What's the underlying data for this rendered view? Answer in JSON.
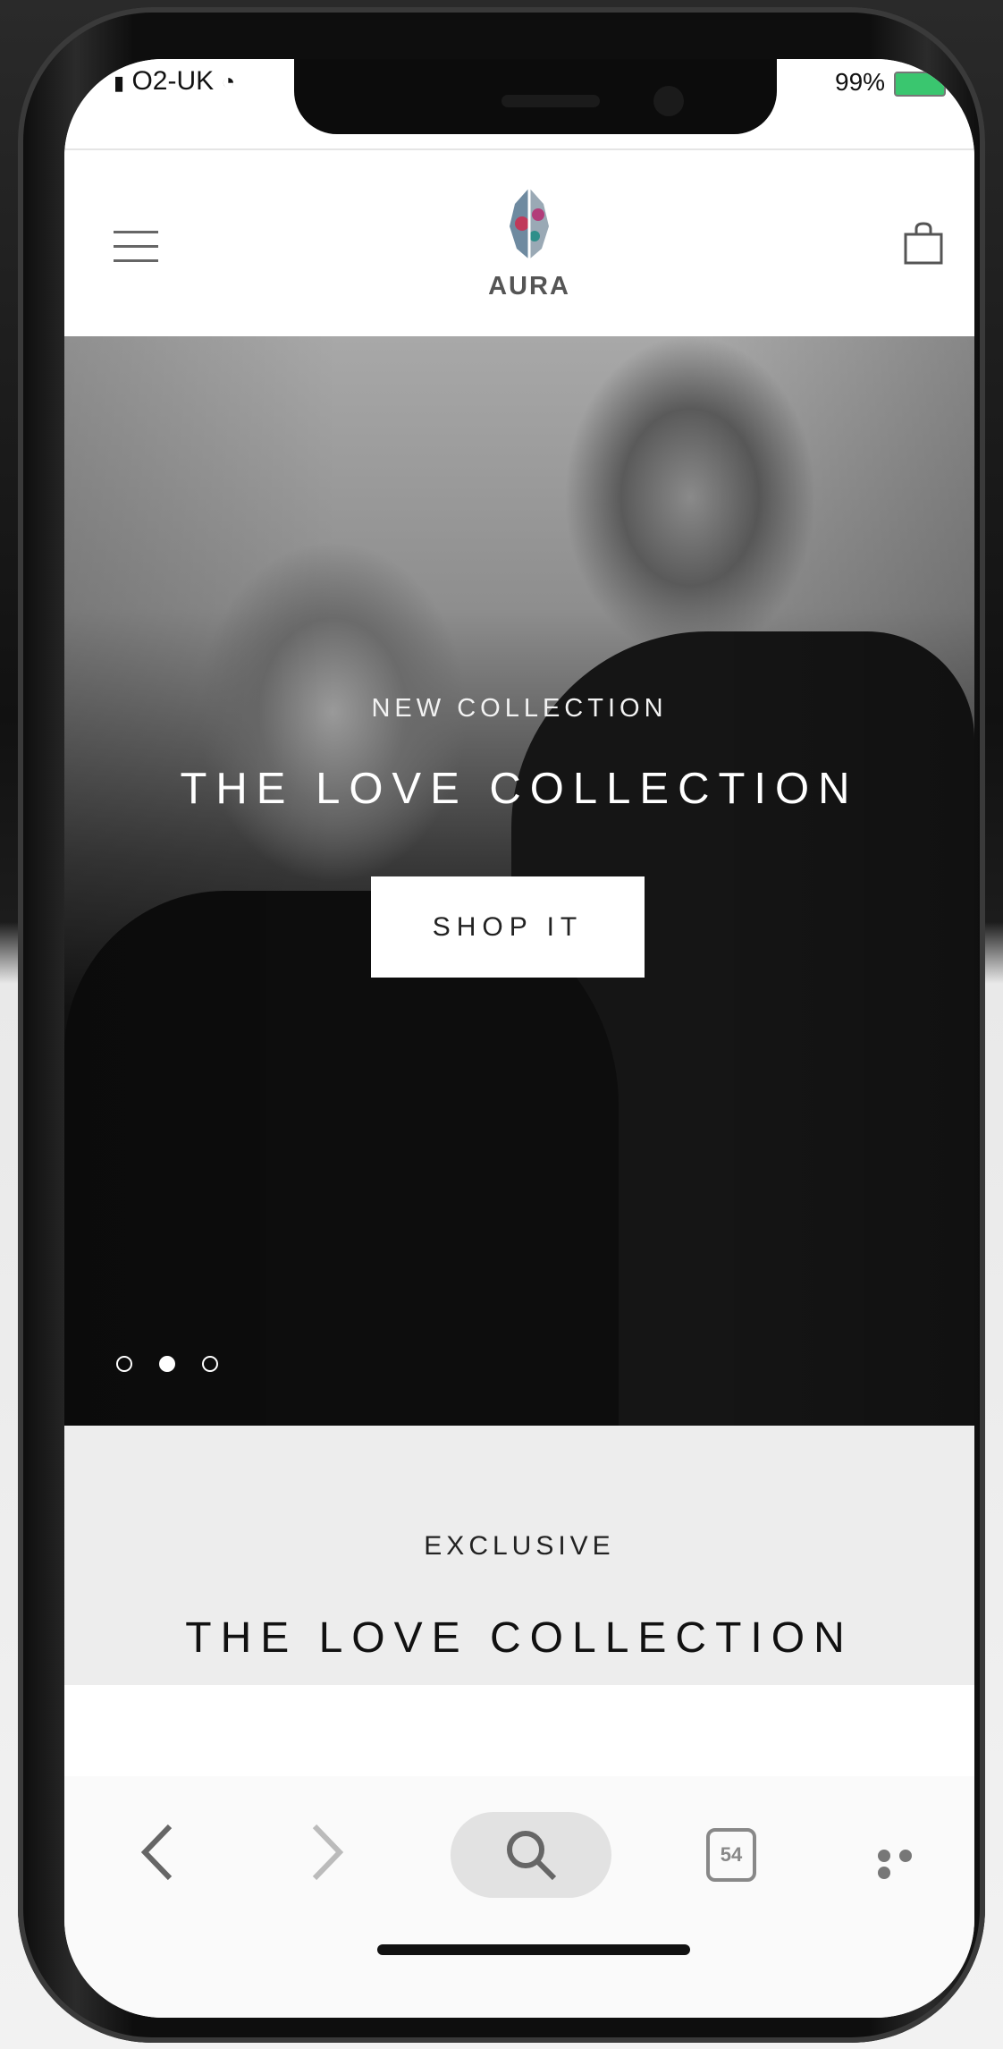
{
  "status": {
    "carrier": "O2-UK",
    "battery": "99%"
  },
  "header": {
    "menu_icon": "hamburger-menu-icon",
    "brand": "AURA",
    "bag_icon": "shopping-bag-icon"
  },
  "hero": {
    "kicker": "NEW COLLECTION",
    "title": "THE LOVE COLLECTION",
    "cta": "SHOP IT",
    "slides_total": 3,
    "active_slide": 2
  },
  "exclusive": {
    "kicker": "EXCLUSIVE",
    "title": "THE LOVE COLLECTION"
  },
  "toolbar": {
    "back_icon": "chevron-left-icon",
    "forward_icon": "chevron-right-icon",
    "search_icon": "search-icon",
    "tab_count": "54",
    "more_icon": "more-dots-icon"
  },
  "colors": {
    "battery": "#3ac66f",
    "hero_text": "#ffffff",
    "section_bg": "#ededed"
  }
}
